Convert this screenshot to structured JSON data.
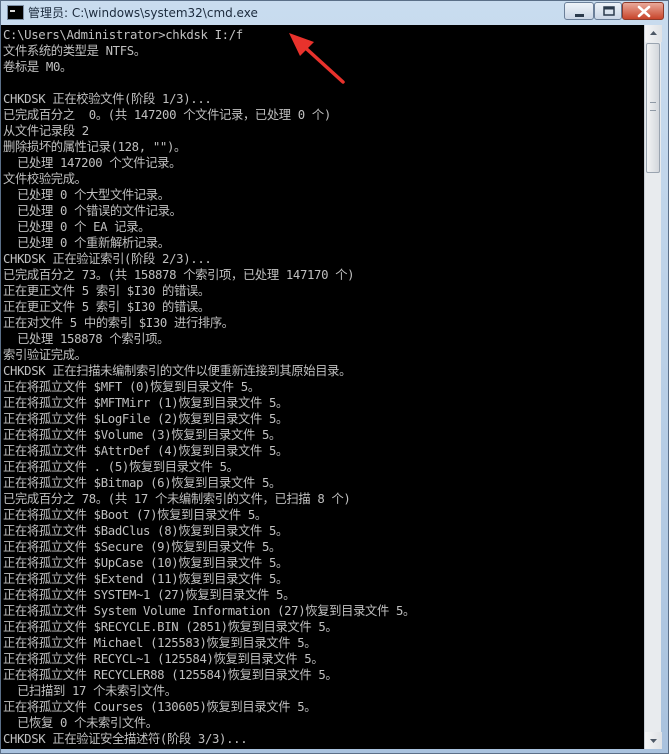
{
  "window": {
    "title": "管理员: C:\\windows\\system32\\cmd.exe"
  },
  "colors": {
    "console_bg": "#000000",
    "console_text": "#c0c0c0",
    "annotation_arrow": "#e8322c"
  },
  "icons": {
    "app": "cmd-icon",
    "minimize": "minimize-icon",
    "maximize": "maximize-icon",
    "close": "close-icon",
    "annotation": "red-arrow-annotation"
  },
  "console": {
    "lines": [
      "C:\\Users\\Administrator>chkdsk I:/f",
      "文件系统的类型是 NTFS。",
      "卷标是 M0。",
      "",
      "CHKDSK 正在校验文件(阶段 1/3)...",
      "已完成百分之  0。(共 147200 个文件记录，已处理 0 个)",
      "从文件记录段 2",
      "删除损坏的属性记录(128, \"\")。",
      "  已处理 147200 个文件记录。",
      "文件校验完成。",
      "  已处理 0 个大型文件记录。",
      "  已处理 0 个错误的文件记录。",
      "  已处理 0 个 EA 记录。",
      "  已处理 0 个重新解析记录。",
      "CHKDSK 正在验证索引(阶段 2/3)...",
      "已完成百分之 73。(共 158878 个索引项，已处理 147170 个)",
      "正在更正文件 5 索引 $I30 的错误。",
      "正在更正文件 5 索引 $I30 的错误。",
      "正在对文件 5 中的索引 $I30 进行排序。",
      "  已处理 158878 个索引项。",
      "索引验证完成。",
      "CHKDSK 正在扫描未编制索引的文件以便重新连接到其原始目录。",
      "正在将孤立文件 $MFT (0)恢复到目录文件 5。",
      "正在将孤立文件 $MFTMirr (1)恢复到目录文件 5。",
      "正在将孤立文件 $LogFile (2)恢复到目录文件 5。",
      "正在将孤立文件 $Volume (3)恢复到目录文件 5。",
      "正在将孤立文件 $AttrDef (4)恢复到目录文件 5。",
      "正在将孤立文件 . (5)恢复到目录文件 5。",
      "正在将孤立文件 $Bitmap (6)恢复到目录文件 5。",
      "已完成百分之 78。(共 17 个未编制索引的文件，已扫描 8 个)",
      "正在将孤立文件 $Boot (7)恢复到目录文件 5。",
      "正在将孤立文件 $BadClus (8)恢复到目录文件 5。",
      "正在将孤立文件 $Secure (9)恢复到目录文件 5。",
      "正在将孤立文件 $UpCase (10)恢复到目录文件 5。",
      "正在将孤立文件 $Extend (11)恢复到目录文件 5。",
      "正在将孤立文件 SYSTEM~1 (27)恢复到目录文件 5。",
      "正在将孤立文件 System Volume Information (27)恢复到目录文件 5。",
      "正在将孤立文件 $RECYCLE.BIN (2851)恢复到目录文件 5。",
      "正在将孤立文件 Michael (125583)恢复到目录文件 5。",
      "正在将孤立文件 RECYCL~1 (125584)恢复到目录文件 5。",
      "正在将孤立文件 RECYCLER88 (125584)恢复到目录文件 5。",
      "  已扫描到 17 个未索引文件。",
      "正在将孤立文件 Courses (130605)恢复到目录文件 5。",
      "  已恢复 0 个未索引文件。",
      "CHKDSK 正在验证安全描述符(阶段 3/3)..."
    ]
  }
}
